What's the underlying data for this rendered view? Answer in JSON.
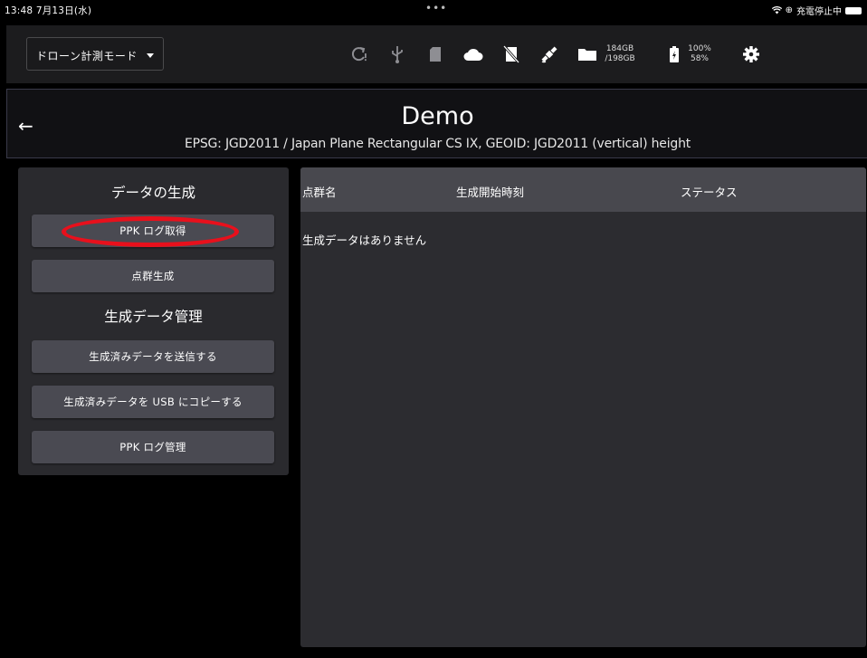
{
  "status_bar": {
    "time": "13:48",
    "date": "7月13日(水)",
    "dots": "•••",
    "right_status": "充電停止中"
  },
  "toolbar": {
    "mode_label": "ドローン計測モード",
    "icons": [
      "refresh-alert-icon",
      "usb-icon",
      "sd-card-icon",
      "cloud-icon",
      "no-sim-icon",
      "satellite-icon",
      "folder-icon",
      "battery-icon",
      "gear-icon"
    ],
    "storage_used": "184GB",
    "storage_total": "/198GB",
    "battery_top": "100%",
    "battery_bottom": "58%"
  },
  "header": {
    "title": "Demo",
    "subtitle": "EPSG: JGD2011 / Japan Plane Rectangular CS IX, GEOID: JGD2011 (vertical) height"
  },
  "left_panel": {
    "section1_title": "データの生成",
    "ppk_log_button": "PPK ログ取得",
    "point_cloud_button": "点群生成",
    "section2_title": "生成データ管理",
    "send_button": "生成済みデータを送信する",
    "usb_copy_button": "生成済みデータを USB にコピーする",
    "ppk_manage_button": "PPK ログ管理"
  },
  "table": {
    "columns": [
      "点群名",
      "生成開始時刻",
      "ステータス"
    ],
    "empty_message": "生成データはありません"
  },
  "colors": {
    "highlight": "#e8101c",
    "panel": "#2a2a2e",
    "button": "#4a4a52",
    "table_header": "#48484e"
  }
}
